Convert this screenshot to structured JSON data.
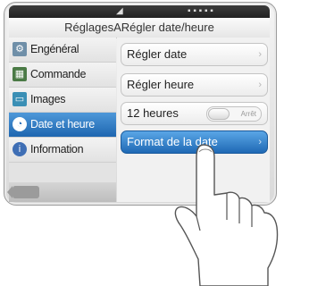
{
  "title": "RéglagesARégler date/heure",
  "sidebar": {
    "items": [
      {
        "label": "Engénéral",
        "icon": "settings-icon",
        "color": "#6f8fa8"
      },
      {
        "label": "Commande",
        "icon": "controls-icon",
        "color": "#4a7a45"
      },
      {
        "label": "Images",
        "icon": "image-icon",
        "color": "#3a8fb5"
      },
      {
        "label": "Date et heure",
        "icon": "clock-icon",
        "color": "#ffffff"
      },
      {
        "label": "Information",
        "icon": "info-icon",
        "color": "#3f6fb5"
      }
    ],
    "active_index": 3
  },
  "main": {
    "rows": [
      {
        "label": "Régler date"
      },
      {
        "label": "Régler heure"
      },
      {
        "label": "12 heures",
        "toggle_text": "Arrêt"
      },
      {
        "label": "Format de la date"
      }
    ],
    "active_index": 3
  },
  "colors": {
    "accent": "#1f69b5"
  }
}
